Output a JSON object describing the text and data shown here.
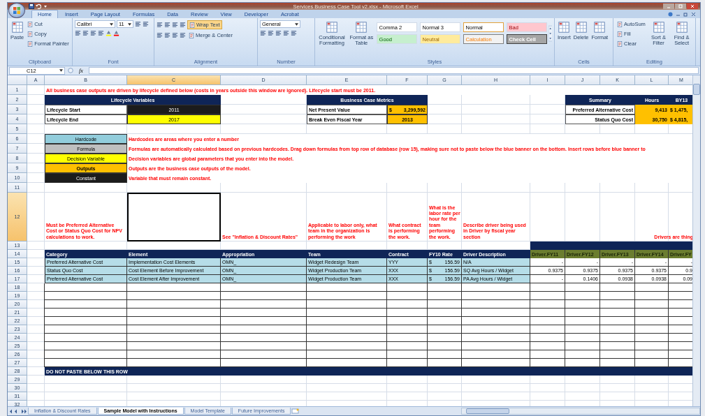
{
  "window": {
    "title": "Services Business Case Tool v2.xlsx - Microsoft Excel"
  },
  "ribbon_tabs": [
    {
      "label": "Home",
      "selected": true
    },
    {
      "label": "Insert",
      "selected": false
    },
    {
      "label": "Page Layout",
      "selected": false
    },
    {
      "label": "Formulas",
      "selected": false
    },
    {
      "label": "Data",
      "selected": false
    },
    {
      "label": "Review",
      "selected": false
    },
    {
      "label": "View",
      "selected": false
    },
    {
      "label": "Developer",
      "selected": false
    },
    {
      "label": "Acrobat",
      "selected": false
    }
  ],
  "ribbon_groups": [
    {
      "kind": "clipboard",
      "label": "Clipboard",
      "items": [
        {
          "kind": "large",
          "label": "Paste"
        },
        {
          "kind": "small",
          "label": "Cut"
        },
        {
          "kind": "small",
          "label": "Copy"
        },
        {
          "kind": "small",
          "label": "Format Painter"
        }
      ]
    },
    {
      "kind": "font",
      "label": "Font",
      "items": [
        {
          "kind": "combo",
          "value": "Calibri"
        },
        {
          "kind": "combo",
          "value": "11"
        }
      ]
    },
    {
      "kind": "alignment",
      "label": "Alignment",
      "items": [
        {
          "kind": "toggle",
          "label": "Wrap Text",
          "on": true
        },
        {
          "kind": "small",
          "label": "Merge & Center"
        }
      ]
    },
    {
      "kind": "number",
      "label": "Number",
      "items": [
        {
          "kind": "combo",
          "value": "General"
        }
      ]
    },
    {
      "kind": "styles",
      "label": "Styles",
      "items": [
        {
          "kind": "large",
          "label": "Conditional Formatting"
        },
        {
          "kind": "large",
          "label": "Format as Table"
        }
      ],
      "gallery": [
        {
          "label": "Comma 2",
          "kind": "plain",
          "selected": false
        },
        {
          "label": "Normal 3",
          "kind": "plain",
          "selected": false
        },
        {
          "label": "Normal",
          "kind": "plain",
          "selected": true
        },
        {
          "label": "Bad",
          "kind": "bad",
          "selected": false
        },
        {
          "label": "Good",
          "kind": "good",
          "selected": false
        },
        {
          "label": "Neutral",
          "kind": "neutral",
          "selected": false
        },
        {
          "label": "Calculation",
          "kind": "calculation",
          "selected": false
        },
        {
          "label": "Check Cell",
          "kind": "check",
          "selected": false
        }
      ]
    },
    {
      "kind": "cells",
      "label": "Cells",
      "items": [
        {
          "kind": "large",
          "label": "Insert"
        },
        {
          "kind": "large",
          "label": "Delete"
        },
        {
          "kind": "large",
          "label": "Format"
        }
      ]
    },
    {
      "kind": "editing",
      "label": "Editing",
      "items": [
        {
          "kind": "small",
          "label": "AutoSum"
        },
        {
          "kind": "small",
          "label": "Fill"
        },
        {
          "kind": "small",
          "label": "Clear"
        },
        {
          "kind": "large",
          "label": "Sort & Filter"
        },
        {
          "kind": "large",
          "label": "Find & Select"
        }
      ]
    }
  ],
  "formula_bar": {
    "name_box": "C12",
    "function_label": "fx"
  },
  "sheet": {
    "columns": [
      {
        "label": "A",
        "selected": false
      },
      {
        "label": "B",
        "selected": false
      },
      {
        "label": "C",
        "selected": true
      },
      {
        "label": "D",
        "selected": false
      },
      {
        "label": "E",
        "selected": false
      },
      {
        "label": "F",
        "selected": false
      },
      {
        "label": "G",
        "selected": false
      },
      {
        "label": "H",
        "selected": false
      },
      {
        "label": "I",
        "selected": false
      },
      {
        "label": "J",
        "selected": false
      },
      {
        "label": "K",
        "selected": false
      },
      {
        "label": "L",
        "selected": false
      },
      {
        "label": "M",
        "selected": false
      }
    ],
    "rows": [
      {
        "label": "1",
        "selected": false
      },
      {
        "label": "2",
        "selected": false
      },
      {
        "label": "3",
        "selected": false
      },
      {
        "label": "4",
        "selected": false
      },
      {
        "label": "5",
        "selected": false
      },
      {
        "label": "6",
        "selected": false
      },
      {
        "label": "7",
        "selected": false
      },
      {
        "label": "8",
        "selected": false
      },
      {
        "label": "9",
        "selected": false
      },
      {
        "label": "10",
        "selected": false
      },
      {
        "label": "11",
        "selected": false
      },
      {
        "label": "12",
        "selected": true
      },
      {
        "label": "13",
        "selected": false
      },
      {
        "label": "14",
        "selected": false
      },
      {
        "label": "15",
        "selected": false
      },
      {
        "label": "16",
        "selected": false
      },
      {
        "label": "17",
        "selected": false
      },
      {
        "label": "18",
        "selected": false
      },
      {
        "label": "19",
        "selected": false
      },
      {
        "label": "20",
        "selected": false
      },
      {
        "label": "21",
        "selected": false
      },
      {
        "label": "22",
        "selected": false
      },
      {
        "label": "23",
        "selected": false
      },
      {
        "label": "24",
        "selected": false
      },
      {
        "label": "25",
        "selected": false
      },
      {
        "label": "26",
        "selected": false
      },
      {
        "label": "27",
        "selected": false
      },
      {
        "label": "28",
        "selected": false
      },
      {
        "label": "29",
        "selected": false
      },
      {
        "label": "30",
        "selected": false
      },
      {
        "label": "31",
        "selected": false
      },
      {
        "label": "32",
        "selected": false
      }
    ],
    "note": "All business case outputs are driven by lifecycle defined below (costs in years outside this window are ignored). Lifecycle start must be 2011.",
    "lifecycle": {
      "title": "Lifecycle Variables",
      "rows": [
        {
          "label": "Lifecycle Start",
          "value": "2011",
          "kind": "constant"
        },
        {
          "label": "Lifecycle End",
          "value": "2017",
          "kind": "decision"
        }
      ]
    },
    "metrics": {
      "title": "Business Case Metrics",
      "rows": [
        {
          "label": "Net Present Value",
          "currency": "$",
          "value": "3,299,592"
        },
        {
          "label": "Break Even Fiscal Year",
          "value": "2013"
        }
      ]
    },
    "summary": {
      "title": "Summary",
      "hours_heading": "Hours",
      "by_heading": "BY13",
      "rows": [
        {
          "label": "Preferred Alternative Cost",
          "hours": "9,413",
          "by": "$ 1,475,"
        },
        {
          "label": "Status Quo Cost",
          "hours": "30,750",
          "by": "$ 4,815,"
        }
      ]
    },
    "legend": [
      {
        "label": "Hardcode",
        "kind": "hardcode",
        "description": "Hardcodes are areas where you enter a number"
      },
      {
        "label": "Formula",
        "kind": "formula",
        "description": "Formulas are automatically calculated based on previous hardcodes. Drag down formulas from top row of database (row 15), making sure not to paste below the blue banner on the bottom. Insert rows before blue banner to"
      },
      {
        "label": "Decision Variable",
        "kind": "decision",
        "description": "Decision variables are global parameters that you enter into the model."
      },
      {
        "label": "Outputs",
        "kind": "outputs",
        "description": "Outputs are the business case outputs of the model."
      },
      {
        "label": "Constant",
        "kind": "constant",
        "description": "Variable that must remain constant."
      }
    ],
    "hints": {
      "category": "Must be Preferred Alternative Cost or Status Quo Cost for NPV calculations to work.",
      "appropriation": "See \"Inflation & Discount Rates\"",
      "team": "Applicable to labor only, what team in the organization is performing the work",
      "contract": "What contract is performing the work.",
      "rate": "What is the labor rate per hour for the team performing the work.",
      "driver_description": "Describe driver being used in Driver by fiscal year section",
      "drivers": "Drivers are thing"
    },
    "table": {
      "columns": [
        "Category",
        "Element",
        "Appropriation",
        "Team",
        "Contract",
        "FY10 Rate",
        "Driver Description"
      ],
      "driver_columns": [
        "Driver.FY11",
        "Driver.FY12",
        "Driver.FY13",
        "Driver.FY14",
        "Driver.FY"
      ],
      "rows": [
        {
          "category": "Preferred Alternative Cost",
          "element": "Implementation Cost Elements",
          "appropriation": "OMN_",
          "team": "Widget Redesign Team",
          "contract": "YYY",
          "currency": "$",
          "rate": "156.59",
          "driver_description": "N/A",
          "drivers": [
            "-",
            "-",
            "-",
            "-",
            "-"
          ]
        },
        {
          "category": "Status Quo Cost",
          "element": "Cost Element Before Improvement",
          "appropriation": "OMN_",
          "team": "Widget Production Team",
          "contract": "XXX",
          "currency": "$",
          "rate": "156.59",
          "driver_description": "SQ Avg Hours / Widget",
          "drivers": [
            "0.9375",
            "0.9375",
            "0.9375",
            "0.9375",
            "0.9"
          ]
        },
        {
          "category": "Preferred Alternative Cost",
          "element": "Cost Element After Improvement",
          "appropriation": "OMN_",
          "team": "Widget Production Team",
          "contract": "XXX",
          "currency": "$",
          "rate": "156.59",
          "driver_description": "PA Avg Hours / Widget",
          "drivers": [
            "-",
            "0.1406",
            "0.0938",
            "0.0938",
            "0.09"
          ]
        }
      ],
      "banner": "DO NOT PASTE BELOW THIS ROW"
    }
  },
  "sheet_tabs": [
    {
      "label": "Inflation & Discount Rates",
      "selected": false
    },
    {
      "label": "Sample Model with Instructions",
      "selected": true
    },
    {
      "label": "Model Template",
      "selected": false
    },
    {
      "label": "Future Improvements",
      "selected": false
    }
  ]
}
